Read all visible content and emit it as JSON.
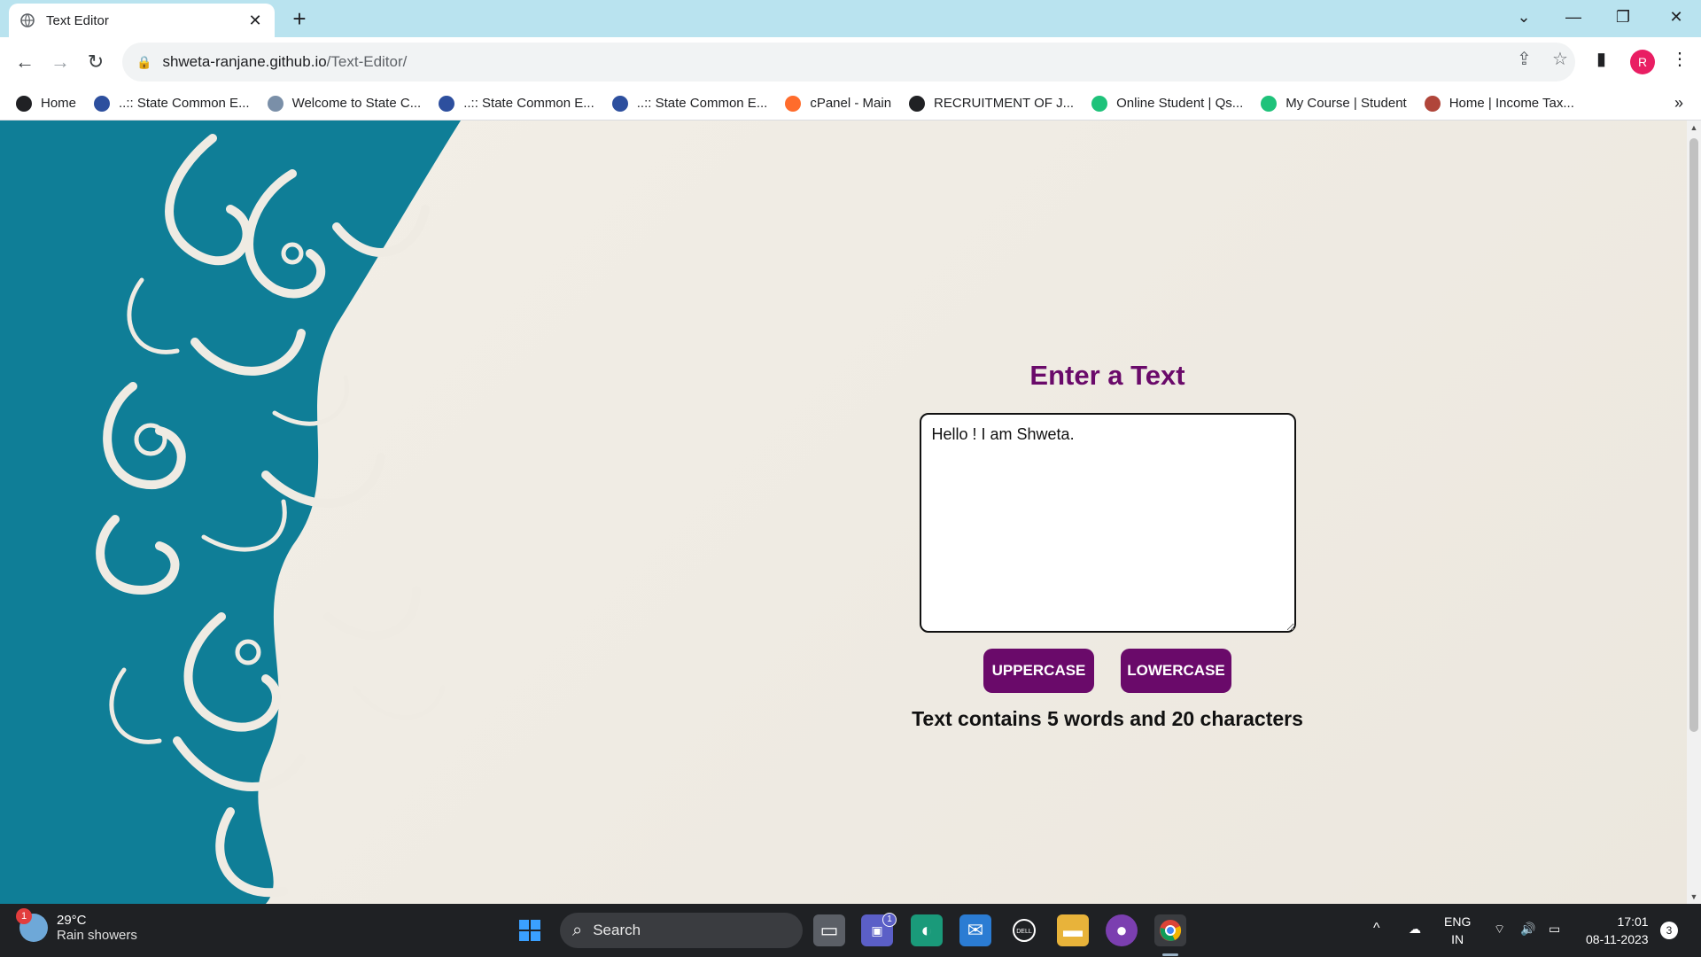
{
  "tab": {
    "title": "Text Editor",
    "close": "✕"
  },
  "toolbar": {
    "url_host": "shweta-ranjane.github.io",
    "url_path": "/Text-Editor/",
    "profile_initial": "R"
  },
  "bookmarks": [
    {
      "label": "Home",
      "icon": "globe-icon",
      "color": "#202124"
    },
    {
      "label": "..:: State Common E...",
      "icon": "cet-logo-icon",
      "color": "#2d4f9e"
    },
    {
      "label": "Welcome to State C...",
      "icon": "page-icon",
      "color": "#7a8fa8"
    },
    {
      "label": "..:: State Common E...",
      "icon": "cet-logo-icon",
      "color": "#2d4f9e"
    },
    {
      "label": "..:: State Common E...",
      "icon": "cet-logo-icon",
      "color": "#2d4f9e"
    },
    {
      "label": "cPanel - Main",
      "icon": "cpanel-icon",
      "color": "#ff6c2c"
    },
    {
      "label": "RECRUITMENT OF J...",
      "icon": "globe-icon",
      "color": "#202124"
    },
    {
      "label": "Online Student | Qs...",
      "icon": "qspiders-icon",
      "color": "#1ec27a"
    },
    {
      "label": "My Course | Student",
      "icon": "qspiders-icon",
      "color": "#1ec27a"
    },
    {
      "label": "Home | Income Tax...",
      "icon": "incometax-icon",
      "color": "#b0453a"
    }
  ],
  "editor": {
    "heading": "Enter a Text",
    "text_value": "Hello ! I am Shweta.",
    "uppercase_label": "UPPERCASE",
    "lowercase_label": "LOWERCASE",
    "summary": "Text contains 5 words and 20 characters"
  },
  "taskbar": {
    "weather_temp": "29°C",
    "weather_cond": "Rain showers",
    "weather_badge": "1",
    "search_label": "Search",
    "lang_top": "ENG",
    "lang_bottom": "IN",
    "time": "17:01",
    "date": "08-11-2023",
    "notif_count": "3",
    "teams_badge": "1"
  },
  "colors": {
    "accent_purple": "#6a0a6a",
    "tabbar": "#b9e3ef",
    "teal_decor": "#0f7e97"
  }
}
